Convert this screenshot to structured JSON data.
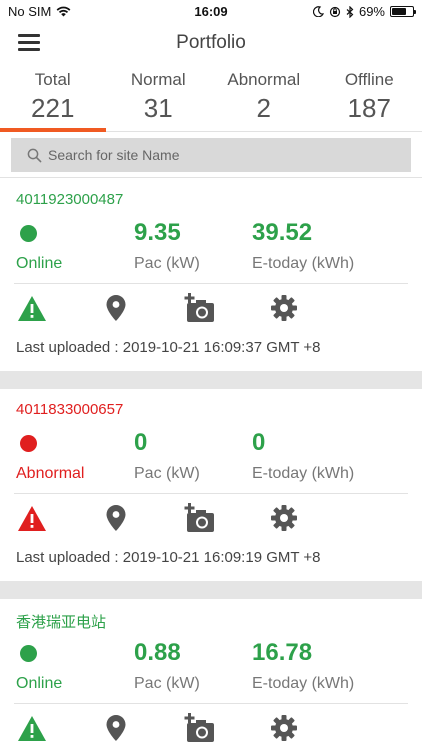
{
  "status_bar": {
    "carrier": "No SIM",
    "time": "16:09",
    "battery": "69%",
    "battery_level": 0.69
  },
  "header": {
    "title": "Portfolio"
  },
  "tabs": [
    {
      "label": "Total",
      "count": "221"
    },
    {
      "label": "Normal",
      "count": "31"
    },
    {
      "label": "Abnormal",
      "count": "2"
    },
    {
      "label": "Offline",
      "count": "187"
    }
  ],
  "active_tab": "Total",
  "search": {
    "placeholder": "Search for site Name"
  },
  "sites": [
    {
      "id": "4011923000487",
      "status": "Online",
      "status_color": "#2da14a",
      "pac": "9.35",
      "pac_label": "Pac (kW)",
      "etoday": "39.52",
      "etoday_label": "E-today (kWh)",
      "last_uploaded": "Last uploaded : 2019-10-21 16:09:37 GMT +8"
    },
    {
      "id": "4011833000657",
      "status": "Abnormal",
      "status_color": "#e01f1f",
      "pac": "0",
      "pac_label": "Pac (kW)",
      "etoday": "0",
      "etoday_label": "E-today (kWh)",
      "last_uploaded": "Last uploaded : 2019-10-21 16:09:19 GMT +8"
    },
    {
      "id": "香港瑞亚电站",
      "status": "Online",
      "status_color": "#2da14a",
      "pac": "0.88",
      "pac_label": "Pac (kW)",
      "etoday": "16.78",
      "etoday_label": "E-today (kWh)",
      "last_uploaded": ""
    }
  ],
  "icons": {
    "alarm": "warning-triangle-icon",
    "location": "location-pin-icon",
    "photo": "add-camera-icon",
    "settings": "gear-icon"
  },
  "colors": {
    "accent": "#f05a22",
    "online": "#2da14a",
    "abnormal": "#e01f1f"
  }
}
